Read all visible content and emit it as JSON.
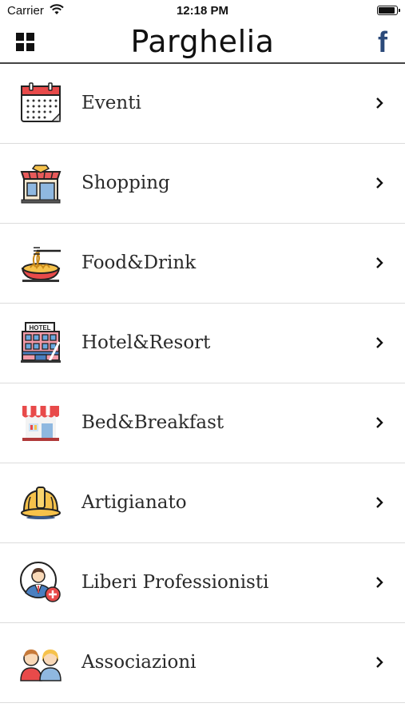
{
  "status_bar": {
    "carrier": "Carrier",
    "time": "12:18 PM"
  },
  "header": {
    "title": "Parghelia",
    "facebook_glyph": "f"
  },
  "menu": {
    "items": [
      {
        "label": "Eventi",
        "icon": "calendar-icon"
      },
      {
        "label": "Shopping",
        "icon": "store-icon"
      },
      {
        "label": "Food&Drink",
        "icon": "spaghetti-icon"
      },
      {
        "label": "Hotel&Resort",
        "icon": "hotel-icon"
      },
      {
        "label": "Bed&Breakfast",
        "icon": "shop-awning-icon"
      },
      {
        "label": "Artigianato",
        "icon": "hard-hat-icon"
      },
      {
        "label": "Liberi Professionisti",
        "icon": "professional-icon"
      },
      {
        "label": "Associazioni",
        "icon": "people-icon"
      }
    ]
  },
  "colors": {
    "facebook": "#2c4a7a",
    "divider": "#dcdcdc",
    "header_border": "#444444"
  }
}
